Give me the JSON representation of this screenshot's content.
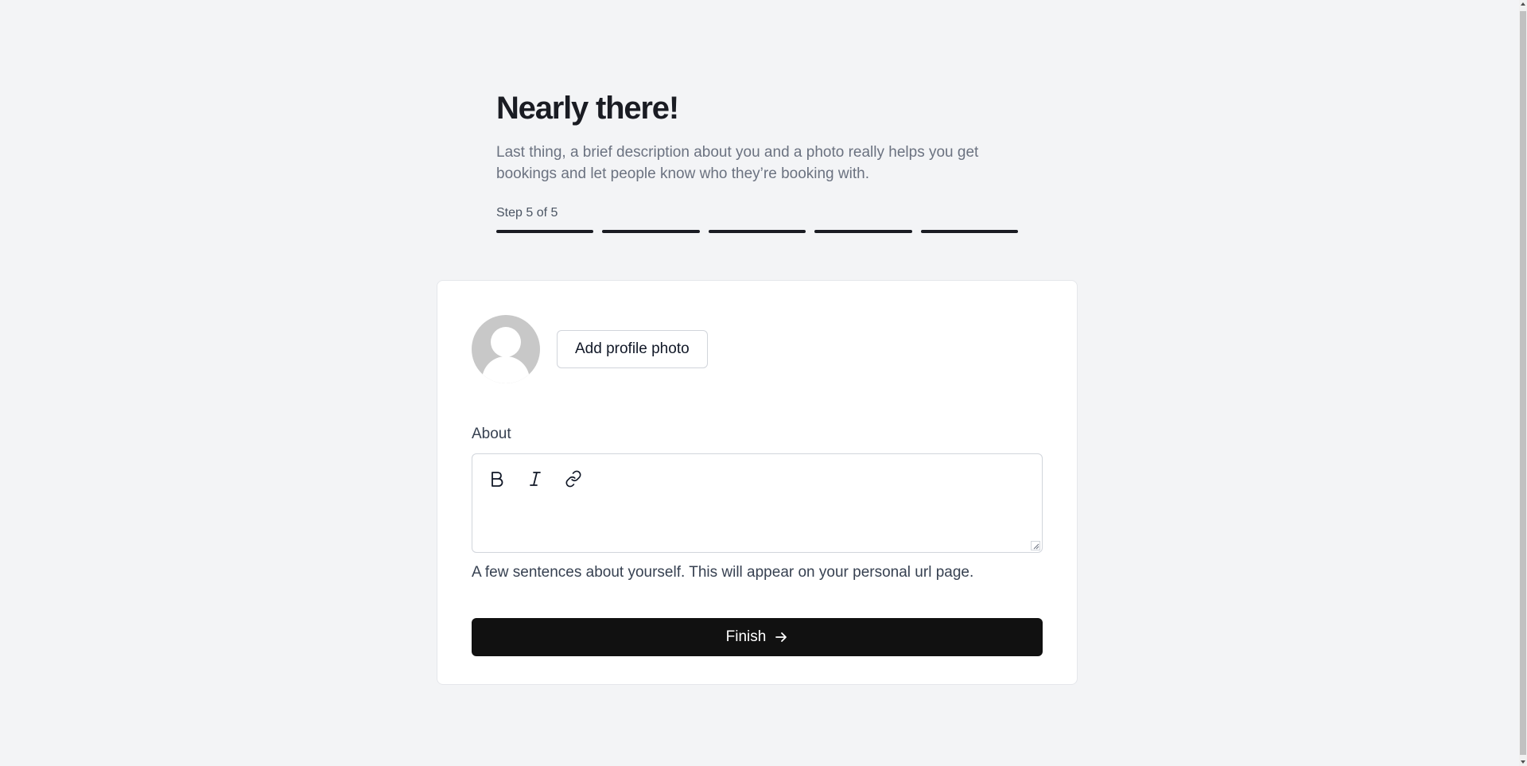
{
  "header": {
    "title": "Nearly there!",
    "subtitle": "Last thing, a brief description about you and a photo really helps you get bookings and let people know who they’re booking with.",
    "step_label": "Step 5 of 5",
    "steps_total": 5,
    "steps_completed": 5
  },
  "profile": {
    "avatar_icon": "user-avatar-placeholder-icon",
    "add_photo_label": "Add profile photo"
  },
  "about": {
    "label": "About",
    "value": "",
    "toolbar": [
      {
        "name": "bold",
        "icon": "bold-icon"
      },
      {
        "name": "italic",
        "icon": "italic-icon"
      },
      {
        "name": "link",
        "icon": "link-icon"
      }
    ],
    "help_text": "A few sentences about yourself. This will appear on your personal url page."
  },
  "finish": {
    "label": "Finish",
    "icon": "arrow-right-icon"
  },
  "colors": {
    "background": "#f3f4f6",
    "accent": "#111111",
    "step_bar": "#1a1c23"
  }
}
